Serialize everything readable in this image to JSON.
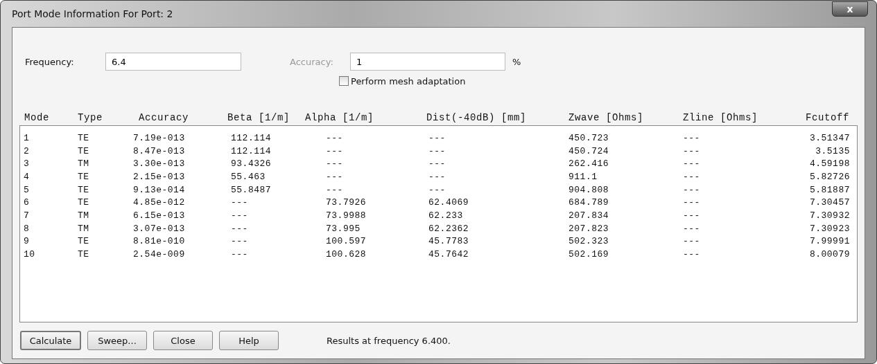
{
  "window": {
    "title": "Port Mode Information For Port: 2",
    "close_button": "x"
  },
  "frequency": {
    "label": "Frequency:",
    "value": "6.4"
  },
  "accuracy": {
    "label": "Accuracy:",
    "disabled": true,
    "value": "1",
    "unit": "%"
  },
  "mesh_adaptation": {
    "label": "Perform mesh adaptation",
    "checked": false
  },
  "table": {
    "columns": [
      "Mode",
      "Type",
      "Accuracy",
      "Beta [1/m]",
      "Alpha [1/m]",
      "Dist(-40dB) [mm]",
      "Zwave [Ohms]",
      "Zline [Ohms]",
      "Fcutoff"
    ],
    "rows": [
      [
        "1",
        "TE",
        "7.19e-013",
        "112.114",
        "---",
        "---",
        "450.723",
        "---",
        "3.51347"
      ],
      [
        "2",
        "TE",
        "8.47e-013",
        "112.114",
        "---",
        "---",
        "450.724",
        "---",
        "3.5135"
      ],
      [
        "3",
        "TM",
        "3.30e-013",
        "93.4326",
        "---",
        "---",
        "262.416",
        "---",
        "4.59198"
      ],
      [
        "4",
        "TE",
        "2.15e-013",
        "55.463",
        "---",
        "---",
        "911.1",
        "---",
        "5.82726"
      ],
      [
        "5",
        "TE",
        "9.13e-014",
        "55.8487",
        "---",
        "---",
        "904.808",
        "---",
        "5.81887"
      ],
      [
        "6",
        "TE",
        "4.85e-012",
        "---",
        "73.7926",
        "62.4069",
        "684.789",
        "---",
        "7.30457"
      ],
      [
        "7",
        "TM",
        "6.15e-013",
        "---",
        "73.9988",
        "62.233",
        "207.834",
        "---",
        "7.30932"
      ],
      [
        "8",
        "TM",
        "3.07e-013",
        "---",
        "73.995",
        "62.2362",
        "207.823",
        "---",
        "7.30923"
      ],
      [
        "9",
        "TE",
        "8.81e-010",
        "---",
        "100.597",
        "45.7783",
        "502.323",
        "---",
        "7.99991"
      ],
      [
        "10",
        "TE",
        "2.54e-009",
        "---",
        "100.628",
        "45.7642",
        "502.169",
        "---",
        "8.00079"
      ]
    ]
  },
  "buttons": [
    {
      "label": "Calculate",
      "default": true
    },
    {
      "label": "Sweep...",
      "default": false
    },
    {
      "label": "Close",
      "default": false
    },
    {
      "label": "Help",
      "default": false
    }
  ],
  "status": "Results at frequency 6.400."
}
